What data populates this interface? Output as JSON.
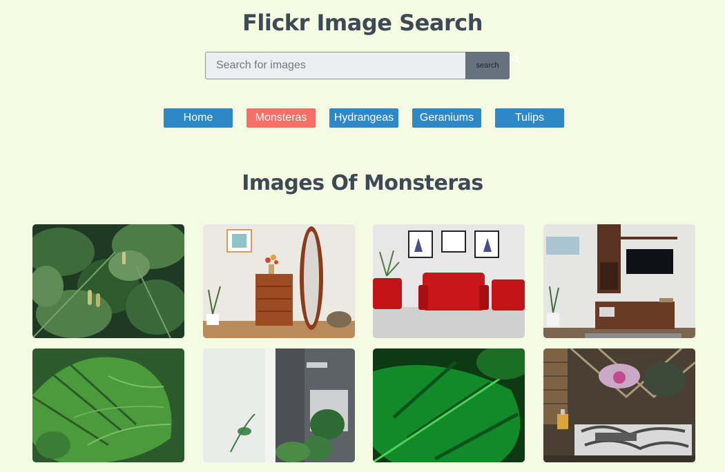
{
  "app": {
    "title": "Flickr Image Search"
  },
  "search": {
    "placeholder": "Search for images",
    "value": "",
    "button_label": "search"
  },
  "nav": {
    "items": [
      {
        "label": "Home",
        "active": false
      },
      {
        "label": "Monsteras",
        "active": true
      },
      {
        "label": "Hydrangeas",
        "active": false
      },
      {
        "label": "Geraniums",
        "active": false
      },
      {
        "label": "Tulips",
        "active": false
      }
    ]
  },
  "gallery": {
    "heading": "Images Of Monsteras",
    "photos": [
      "monstera-jungle",
      "orange-dresser-mirror",
      "red-sofa-living-room",
      "tv-wall-unit",
      "monstera-leaf-closeup",
      "window-monstera",
      "dark-green-leaf",
      "tropical-bedroom"
    ]
  },
  "colors": {
    "background": "#f5fae3",
    "nav_button": "#2e88c5",
    "nav_active": "#f76e66",
    "search_button": "#66737f",
    "title": "#3d4a55"
  }
}
